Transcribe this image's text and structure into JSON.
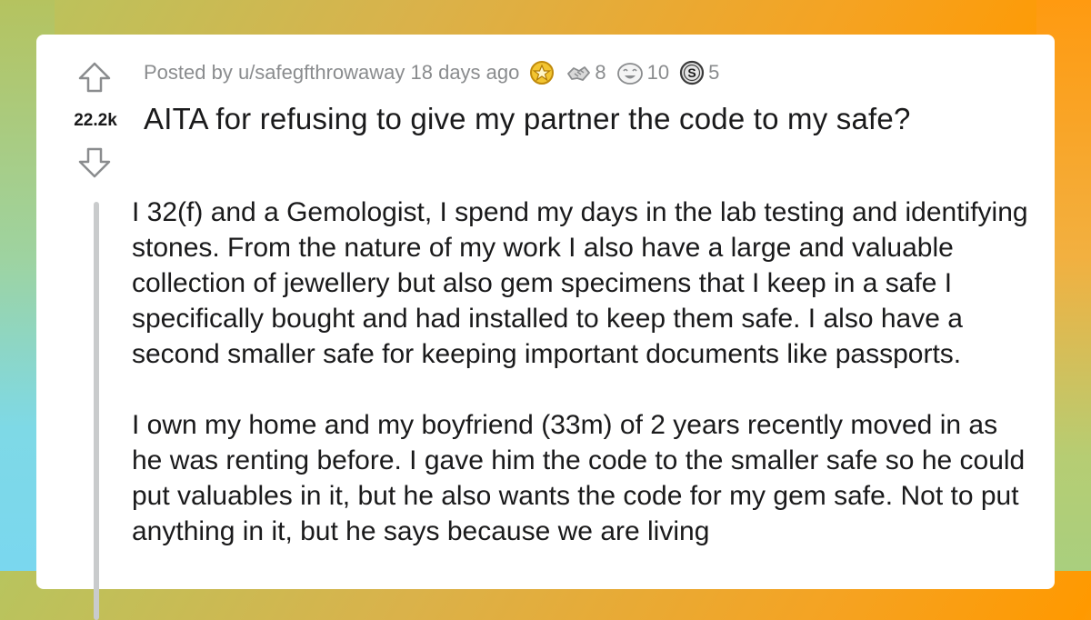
{
  "post": {
    "posted_by": "Posted by u/safegfthrowaway 18 days ago",
    "score": "22.2k",
    "title": "AITA for refusing to give my partner the code to my safe?",
    "awards": [
      {
        "icon": "gold-star-award-icon",
        "count": ""
      },
      {
        "icon": "handshake-award-icon",
        "count": "8"
      },
      {
        "icon": "laughing-face-award-icon",
        "count": "10"
      },
      {
        "icon": "silver-coin-award-icon",
        "count": "5"
      }
    ],
    "paragraphs": [
      "I 32(f) and a Gemologist, I spend my days in the lab testing and identifying stones. From the nature of my work I also have a large and valuable collection of jewellery but also gem specimens that I keep in a safe I specifically bought and had installed to keep them safe. I also have a second smaller safe for keeping important documents like passports.",
      "I own my home and my boyfriend (33m) of 2 years recently moved in as he was renting before. I gave him the code to the smaller safe so he could put valuables in it, but he also wants the code for my gem safe. Not to put anything in it, but he says because we are living"
    ]
  },
  "colors": {
    "card_bg": "#ffffff",
    "text": "#1a1a1b",
    "meta_text": "#8a8c8e",
    "quote_bar": "#c9cbcc"
  }
}
